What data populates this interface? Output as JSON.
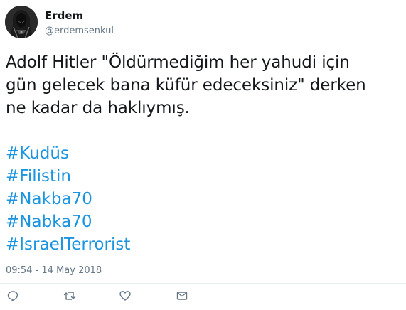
{
  "tweet": {
    "author": {
      "name": "Erdem",
      "handle": "@erdemsenkul"
    },
    "text": "Adolf Hitler \"Öldürmediğim her yahudi için\ngün gelecek bana küfür edeceksiniz\" derken\nne kadar da haklıymış.",
    "hashtags": [
      "#Kudüs",
      "#Filistin",
      "#Nakba70",
      "#Nabka70",
      "#IsraelTerrorist"
    ],
    "timestamp": "09:54 - 14 May 2018",
    "actions": [
      {
        "name": "reply",
        "icon": "reply-icon"
      },
      {
        "name": "retweet",
        "icon": "retweet-icon"
      },
      {
        "name": "like",
        "icon": "heart-icon"
      },
      {
        "name": "message",
        "icon": "envelope-icon"
      }
    ]
  },
  "colors": {
    "text": "#14171a",
    "secondary": "#657786",
    "link": "#1b95e0",
    "divider": "#e6ecf0"
  }
}
